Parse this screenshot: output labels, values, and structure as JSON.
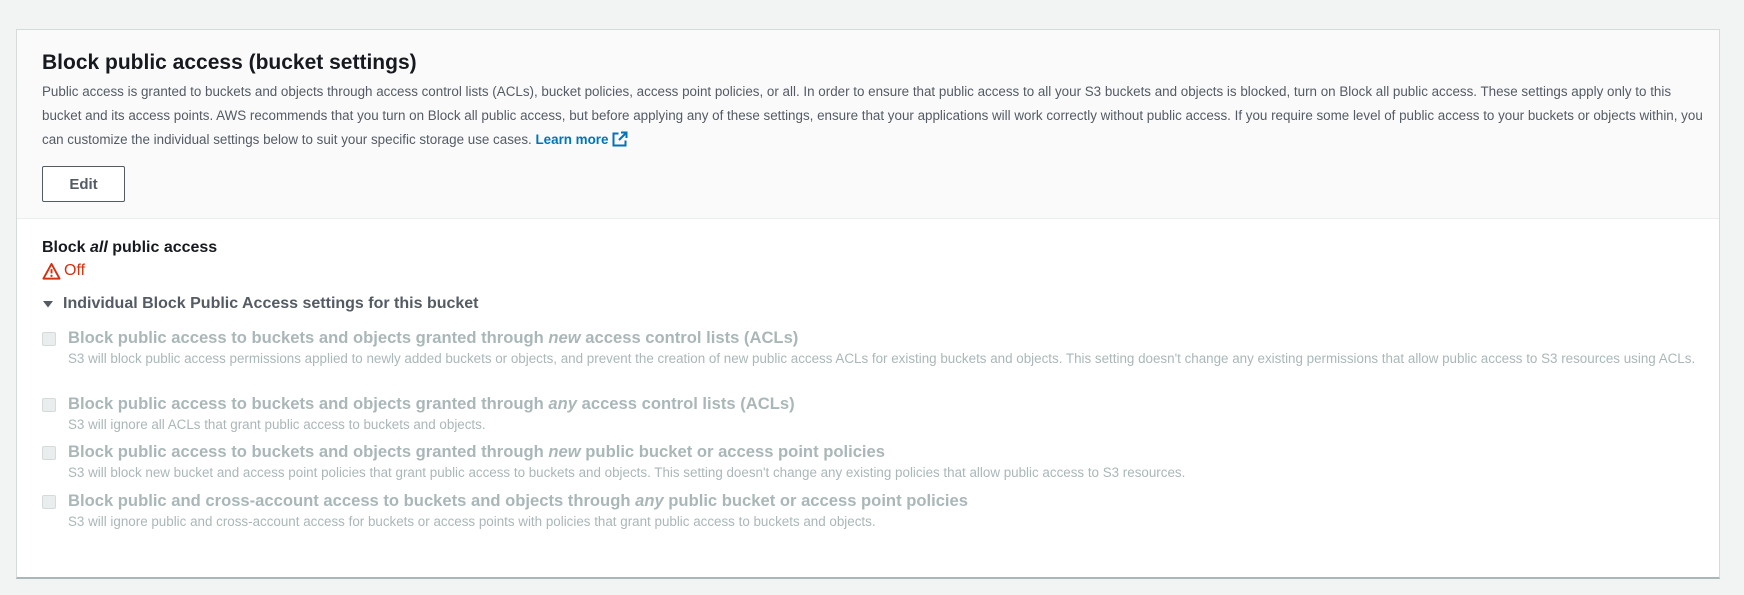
{
  "panel": {
    "title": "Block public access (bucket settings)",
    "description": "Public access is granted to buckets and objects through access control lists (ACLs), bucket policies, access point policies, or all. In order to ensure that public access to all your S3 buckets and objects is blocked, turn on Block all public access. These settings apply only to this bucket and its access points. AWS recommends that you turn on Block all public access, but before applying any of these settings, ensure that your applications will work correctly without public access. If you require some level of public access to your buckets or objects within, you can customize the individual settings below to suit your specific storage use cases.",
    "learn_more": "Learn more",
    "edit_label": "Edit"
  },
  "block_all": {
    "label_prefix": "Block ",
    "label_emph": "all",
    "label_suffix": " public access",
    "status": "Off",
    "status_color": "#d13212"
  },
  "individual": {
    "expander_label": "Individual Block Public Access settings for this bucket",
    "settings": [
      {
        "title_prefix": "Block public access to buckets and objects granted through ",
        "title_emph": "new",
        "title_suffix": " access control lists (ACLs)",
        "description": "S3 will block public access permissions applied to newly added buckets or objects, and prevent the creation of new public access ACLs for existing buckets and objects. This setting doesn't change any existing permissions that allow public access to S3 resources using ACLs.",
        "checked": false
      },
      {
        "title_prefix": "Block public access to buckets and objects granted through ",
        "title_emph": "any",
        "title_suffix": " access control lists (ACLs)",
        "description": "S3 will ignore all ACLs that grant public access to buckets and objects.",
        "checked": false
      },
      {
        "title_prefix": "Block public access to buckets and objects granted through ",
        "title_emph": "new",
        "title_suffix": " public bucket or access point policies",
        "description": "S3 will block new bucket and access point policies that grant public access to buckets and objects. This setting doesn't change any existing policies that allow public access to S3 resources.",
        "checked": false
      },
      {
        "title_prefix": "Block public and cross-account access to buckets and objects through ",
        "title_emph": "any",
        "title_suffix": " public bucket or access point policies",
        "description": "S3 will ignore public and cross-account access for buckets or access points with policies that grant public access to buckets and objects.",
        "checked": false
      }
    ]
  },
  "colors": {
    "link": "#0073bb",
    "disabled_text": "#aab7b8",
    "warning": "#d13212"
  }
}
